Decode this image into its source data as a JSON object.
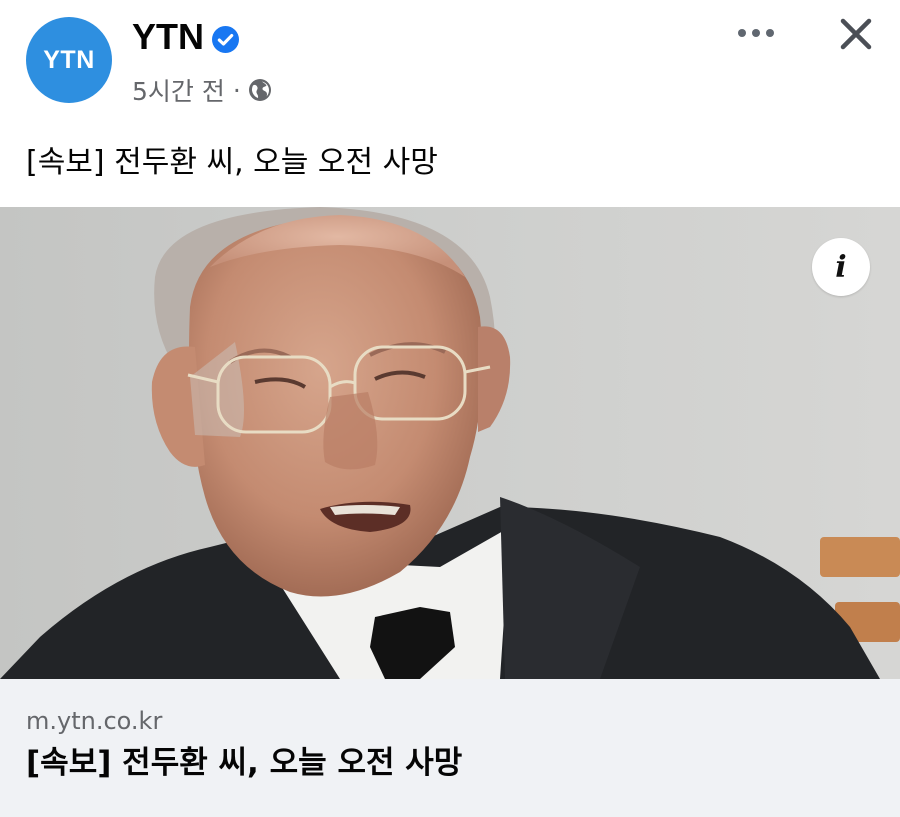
{
  "post": {
    "page_avatar_text": "YTN",
    "page_name": "YTN",
    "time": "5시간 전",
    "separator": "·",
    "text": "[속보] 전두환 씨, 오늘 오전 사망"
  },
  "link": {
    "domain": "m.ytn.co.kr",
    "title": "[속보] 전두환 씨, 오늘 오전 사망"
  },
  "icons": {
    "verified": "verified-badge-icon",
    "audience": "globe-icon",
    "more": "more-options-icon",
    "close": "close-icon",
    "info": "info-icon"
  },
  "colors": {
    "brand_blue": "#2e8fe0",
    "verified_blue": "#1877f2",
    "secondary_text": "#65676b",
    "link_footer_bg": "#f0f2f5"
  }
}
